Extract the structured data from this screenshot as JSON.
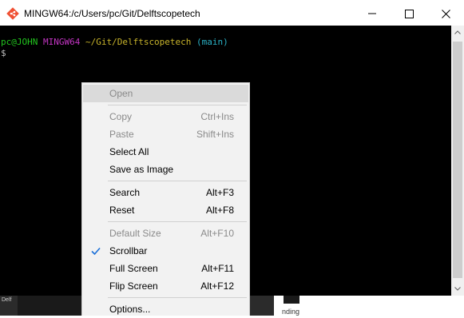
{
  "window": {
    "title": "MINGW64:/c/Users/pc/Git/Delftscopetech"
  },
  "terminal": {
    "user_host": "pc@JOHN",
    "system": "MINGW64",
    "path": "~/Git/Delftscopetech",
    "branch": "(main)",
    "dollar": "$",
    "colors": {
      "user_host": "#22c51e",
      "system": "#c335c3",
      "path": "#c8b42b",
      "branch": "#2bb3c8"
    }
  },
  "context_menu": {
    "items": [
      {
        "label": "Open",
        "shortcut": "",
        "disabled": true,
        "hovered": true
      },
      {
        "label": "Copy",
        "shortcut": "Ctrl+Ins",
        "disabled": true
      },
      {
        "label": "Paste",
        "shortcut": "Shift+Ins",
        "disabled": true
      },
      {
        "label": "Select All",
        "shortcut": "",
        "disabled": false
      },
      {
        "label": "Save as Image",
        "shortcut": "",
        "disabled": false
      },
      {
        "label": "Search",
        "shortcut": "Alt+F3",
        "disabled": false
      },
      {
        "label": "Reset",
        "shortcut": "Alt+F8",
        "disabled": false
      },
      {
        "label": "Default Size",
        "shortcut": "Alt+F10",
        "disabled": true
      },
      {
        "label": "Scrollbar",
        "shortcut": "",
        "disabled": false,
        "checked": true
      },
      {
        "label": "Full Screen",
        "shortcut": "Alt+F11",
        "disabled": false
      },
      {
        "label": "Flip Screen",
        "shortcut": "Alt+F12",
        "disabled": false
      },
      {
        "label": "Options...",
        "shortcut": "",
        "disabled": false
      }
    ],
    "check_color": "#1a6fd8"
  },
  "background": {
    "taskbar_fragment_text": "Delf",
    "window_fragment_text": "nding"
  },
  "icons": {
    "app": "git-bash-icon",
    "minimize": "minimize-icon",
    "maximize": "maximize-icon",
    "close": "close-icon"
  }
}
